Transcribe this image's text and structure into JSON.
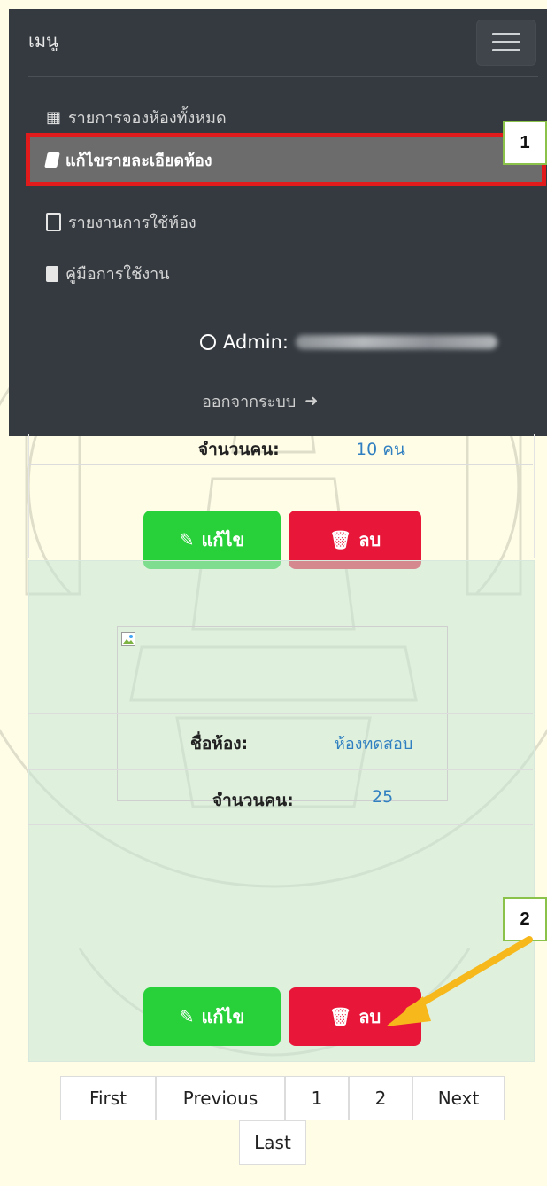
{
  "navbar": {
    "brand": "เมนู",
    "items": [
      {
        "icon": "table-icon",
        "glyph": "▦",
        "label": "รายการจองห้องทั้งหมด"
      },
      {
        "icon": "book-icon",
        "glyph": "▰",
        "label": "แก้ไขรายละเอียดห้อง"
      },
      {
        "icon": "file-icon",
        "glyph": "□",
        "label": "รายงานการใช้ห้อง"
      },
      {
        "icon": "file-text-icon",
        "glyph": "▤",
        "label": "คู่มือการใช้งาน"
      }
    ],
    "admin_label": "Admin:",
    "logout_label": "ออกจากระบบ"
  },
  "callouts": {
    "one": "1",
    "two": "2"
  },
  "rooms": [
    {
      "count_label": "จำนวนคน:",
      "count_value": "10 คน",
      "edit_label": "แก้ไข",
      "delete_label": "ลบ"
    },
    {
      "name_label": "ชื่อห้อง:",
      "name_value": "ห้องทดสอบ",
      "count_label": "จำนวนคน:",
      "count_value": "25",
      "edit_label": "แก้ไข",
      "delete_label": "ลบ"
    }
  ],
  "pagination": {
    "first": "First",
    "previous": "Previous",
    "page1": "1",
    "page2": "2",
    "next": "Next",
    "last": "Last"
  },
  "colors": {
    "navbar_bg": "#343a40",
    "edit_button": "#28d13a",
    "delete_button": "#e8173a",
    "highlight_border": "#e11b1b",
    "arrow": "#f7b81c",
    "value_text": "#2f7fc1"
  }
}
